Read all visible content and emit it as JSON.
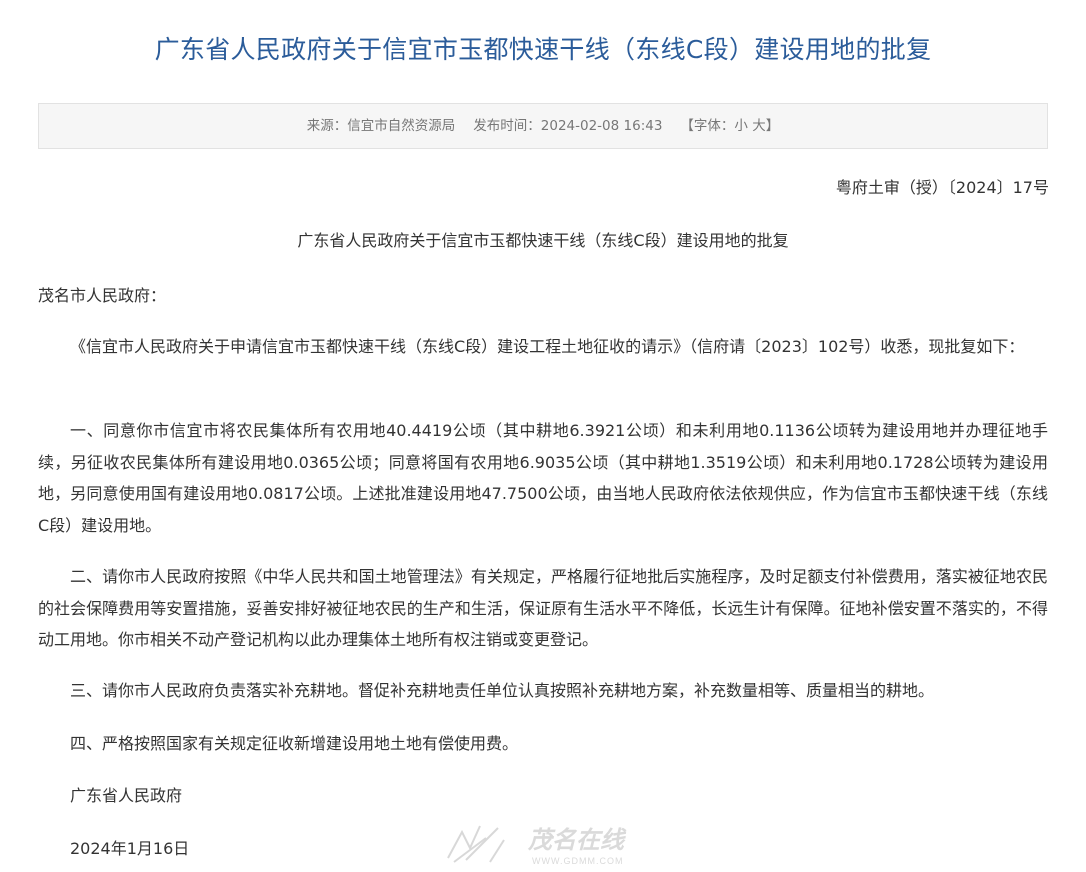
{
  "article": {
    "title": "广东省人民政府关于信宜市玉都快速干线（东线C段）建设用地的批复",
    "meta": {
      "source": "来源：信宜市自然资源局",
      "published": "发布时间：2024-02-08 16:43",
      "font_open": "【字体：",
      "font_small": "小",
      "font_large": "大",
      "font_close": "】"
    },
    "doc_number": "粤府土审（授）〔2024〕17号",
    "doc_title": "广东省人民政府关于信宜市玉都快速干线（东线C段）建设用地的批复",
    "addressee": "茂名市人民政府：",
    "paragraphs": [
      "《信宜市人民政府关于申请信宜市玉都快速干线（东线C段）建设工程土地征收的请示》（信府请〔2023〕102号）收悉，现批复如下：",
      "一、同意你市信宜市将农民集体所有农用地40.4419公顷（其中耕地6.3921公顷）和未利用地0.1136公顷转为建设用地并办理征地手续，另征收农民集体所有建设用地0.0365公顷；同意将国有农用地6.9035公顷（其中耕地1.3519公顷）和未利用地0.1728公顷转为建设用地，另同意使用国有建设用地0.0817公顷。上述批准建设用地47.7500公顷，由当地人民政府依法依规供应，作为信宜市玉都快速干线（东线C段）建设用地。",
      "二、请你市人民政府按照《中华人民共和国土地管理法》有关规定，严格履行征地批后实施程序，及时足额支付补偿费用，落实被征地农民的社会保障费用等安置措施，妥善安排好被征地农民的生产和生活，保证原有生活水平不降低，长远生计有保障。征地补偿安置不落实的，不得动工用地。你市相关不动产登记机构以此办理集体土地所有权注销或变更登记。",
      "三、请你市人民政府负责落实补充耕地。督促补充耕地责任单位认真按照补充耕地方案，补充数量相等、质量相当的耕地。",
      "四、严格按照国家有关规定征收新增建设用地土地有偿使用费。"
    ],
    "signature": "广东省人民政府",
    "date": "2024年1月16日"
  },
  "watermark": {
    "text": "茂名在线",
    "url_text": "WWW.GDMM.COM"
  }
}
